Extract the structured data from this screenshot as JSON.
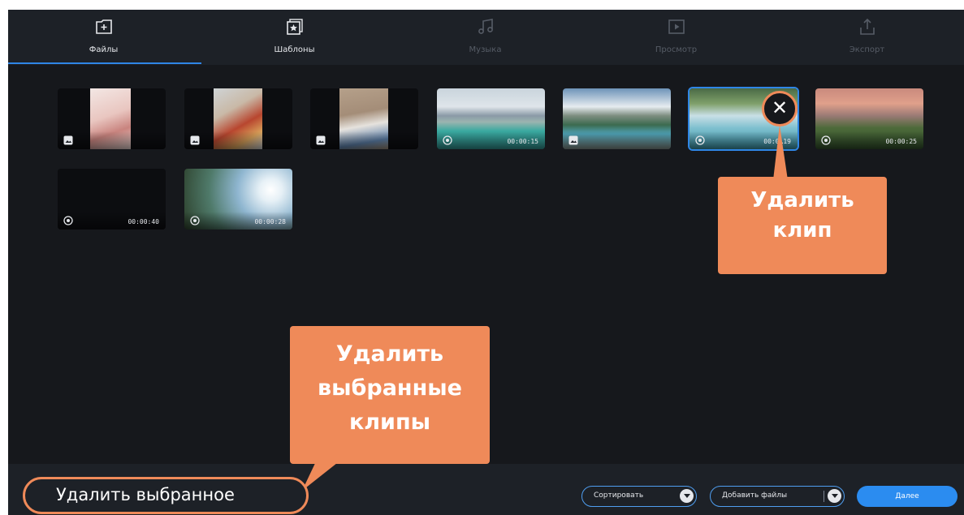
{
  "tabs": [
    {
      "label": "Файлы",
      "icon": "add-file-icon",
      "active": true
    },
    {
      "label": "Шаблоны",
      "icon": "templates-icon",
      "active": false
    },
    {
      "label": "Музыка",
      "icon": "music-note-icon",
      "active": false
    },
    {
      "label": "Просмотр",
      "icon": "preview-play-icon",
      "active": false
    },
    {
      "label": "Экспорт",
      "icon": "export-icon",
      "active": false
    }
  ],
  "clips": [
    {
      "kind": "image",
      "duration": "",
      "icon": "image-icon"
    },
    {
      "kind": "image",
      "duration": "",
      "icon": "image-icon"
    },
    {
      "kind": "image",
      "duration": "",
      "icon": "image-icon"
    },
    {
      "kind": "video",
      "duration": "00:00:15",
      "icon": "video-icon"
    },
    {
      "kind": "image",
      "duration": "",
      "icon": "image-icon"
    },
    {
      "kind": "video",
      "duration": "00:0…19",
      "icon": "video-icon",
      "selected": true
    },
    {
      "kind": "video",
      "duration": "00:00:25",
      "icon": "video-icon"
    },
    {
      "kind": "video",
      "duration": "00:00:40",
      "icon": "video-icon"
    },
    {
      "kind": "video",
      "duration": "00:00:28",
      "icon": "video-icon"
    }
  ],
  "callouts": {
    "remove_clip": [
      "Удалить",
      "клип"
    ],
    "remove_selected": [
      "Удалить",
      "выбранные",
      "клипы"
    ]
  },
  "bottom": {
    "delete_selected": "Удалить выбранное",
    "sort": "Сортировать",
    "add_files": "Добавить файлы",
    "next": "Далее"
  },
  "colors": {
    "accent": "#2f86e6",
    "callout": "#ef8a59",
    "background": "#16181c",
    "bar": "#1d2127"
  }
}
